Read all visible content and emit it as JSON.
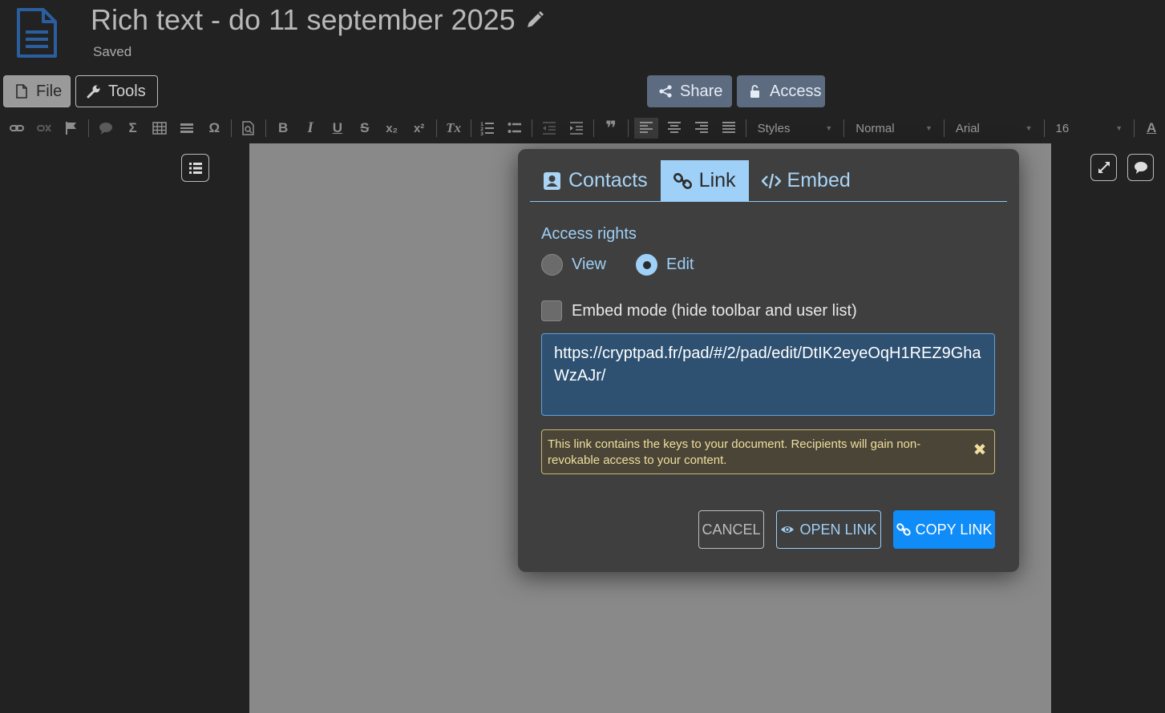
{
  "header": {
    "title": "Rich text - do 11 september 2025",
    "status": "Saved"
  },
  "top_buttons": {
    "file": "File",
    "tools": "Tools",
    "share": "Share",
    "access": "Access"
  },
  "toolbar": {
    "styles": "Styles",
    "format": "Normal",
    "font": "Arial",
    "size": "16"
  },
  "modal": {
    "tabs": [
      {
        "label": "Contacts",
        "icon": "contacts-icon",
        "active": false
      },
      {
        "label": "Link",
        "icon": "link-icon",
        "active": true
      },
      {
        "label": "Embed",
        "icon": "code-icon",
        "active": false
      }
    ],
    "access_rights_label": "Access rights",
    "radio_view": "View",
    "radio_edit": "Edit",
    "selected_right": "Edit",
    "embed_mode_label": "Embed mode (hide toolbar and user list)",
    "embed_mode_checked": false,
    "link_url": "https://cryptpad.fr/pad/#/2/pad/edit/DtIK2eyeOqH1REZ9GhaWzAJr/",
    "warning": "This link contains the keys to your document. Recipients will gain non-revokable access to your content.",
    "cancel": "CANCEL",
    "open_link": "OPEN LINK",
    "copy_link": "COPY LINK"
  },
  "colors": {
    "background": "#222222",
    "page": "#898989",
    "modal": "#3f3f3f",
    "accent": "#9fd0f7",
    "primary": "#0f8cf7",
    "warning_bg": "#4a4536"
  }
}
